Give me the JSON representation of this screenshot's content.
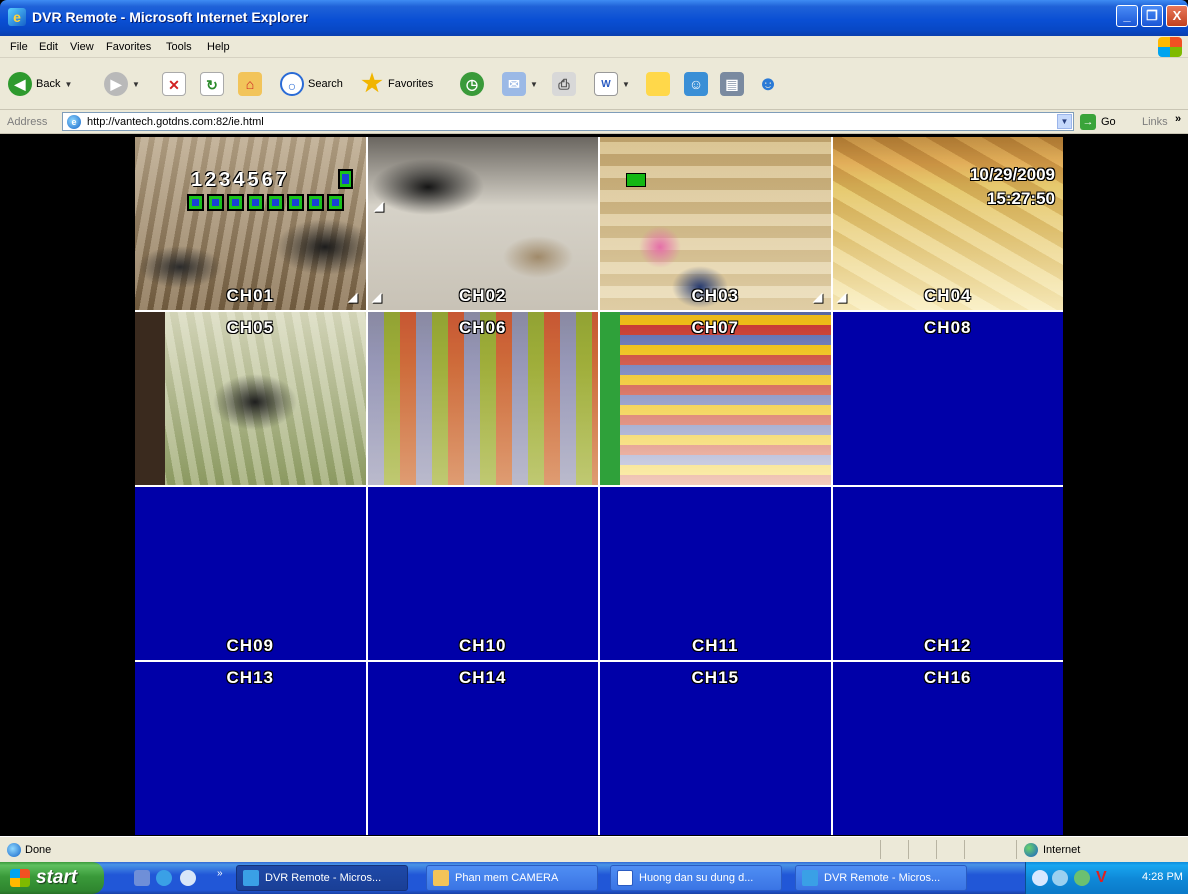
{
  "window": {
    "title": "DVR Remote - Microsoft Internet Explorer",
    "controls": [
      "_",
      "❐",
      "X"
    ]
  },
  "menu": [
    "File",
    "Edit",
    "View",
    "Favorites",
    "Tools",
    "Help"
  ],
  "toolbar": {
    "back_label": "Back",
    "search_label": "Search",
    "favorites_label": "Favorites"
  },
  "address_bar": {
    "label": "Address",
    "url": "http://vantech.gotdns.com:82/ie.html",
    "go_label": "Go",
    "links_label": "Links",
    "links_chevron": "»"
  },
  "dvr": {
    "osd_numbers": "1234567",
    "osd_date": "10/29/2009",
    "osd_time": "15:27:50",
    "channels": [
      "CH01",
      "CH02",
      "CH03",
      "CH04",
      "CH05",
      "CH06",
      "CH07",
      "CH08",
      "CH09",
      "CH10",
      "CH11",
      "CH12",
      "CH13",
      "CH14",
      "CH15",
      "CH16"
    ]
  },
  "status_bar": {
    "status": "Done",
    "zone": "Internet"
  },
  "taskbar": {
    "start_label": "start",
    "quicklaunch_chevron": "»",
    "tasks": [
      "DVR Remote - Micros...",
      "Phan mem CAMERA",
      "Huong dan su dung d...",
      "DVR Remote - Micros..."
    ],
    "clock": "4:28 PM"
  },
  "colors": {
    "titlebar_blue": "#0a4fd4",
    "chrome_gray": "#ece9d8",
    "dvr_no_signal_blue": "#0000a8",
    "grid_line": "#ffffff",
    "start_green": "#3a9a3a",
    "taskbar_blue": "#2157d7"
  },
  "icons": {
    "back": "back-arrow-icon",
    "forward": "forward-arrow-icon",
    "stop": "stop-icon",
    "refresh": "refresh-icon",
    "home": "home-icon",
    "search": "search-icon",
    "favorites": "favorites-star-icon",
    "history": "history-icon",
    "mail": "mail-icon",
    "print": "print-icon",
    "edit": "edit-icon",
    "speaker": "speaker-icon"
  }
}
